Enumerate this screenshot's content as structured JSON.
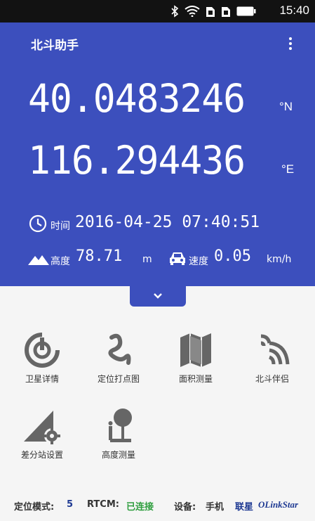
{
  "status_bar": {
    "time": "15:40",
    "icons": [
      "bluetooth-icon",
      "wifi-icon",
      "sim1-icon",
      "sim2-icon",
      "battery-icon"
    ]
  },
  "app": {
    "title": "北斗助手"
  },
  "position": {
    "latitude": "40.0483246",
    "latitude_unit": "°N",
    "longitude": "116.294436",
    "longitude_unit": "°E"
  },
  "time_row": {
    "label": "时间",
    "value": "2016-04-25 07:40:51"
  },
  "altitude": {
    "label": "高度",
    "value": "78.71",
    "unit": "m"
  },
  "speed": {
    "label": "速度",
    "value": "0.05",
    "unit": "km/h"
  },
  "features": [
    {
      "label": "卫星详情",
      "icon": "satellite-radar-icon"
    },
    {
      "label": "定位打点图",
      "icon": "track-path-icon"
    },
    {
      "label": "面积测量",
      "icon": "map-fold-icon"
    },
    {
      "label": "北斗伴侣",
      "icon": "signal-arcs-icon"
    },
    {
      "label": "差分站设置",
      "icon": "station-gear-icon"
    },
    {
      "label": "高度测量",
      "icon": "height-measure-icon"
    }
  ],
  "footer": {
    "mode_label": "定位模式:",
    "mode_value": "5",
    "rtcm_label": "RTCM:",
    "rtcm_value": "已连接",
    "device_label": "设备:",
    "device_value": "手机",
    "brand_cn": "联星",
    "brand_en": "OLinkStar"
  },
  "colors": {
    "primary": "#3c4fbd",
    "icon_gray": "#666666",
    "connected_green": "#2e9e3e",
    "mode_blue": "#1f3a93"
  }
}
